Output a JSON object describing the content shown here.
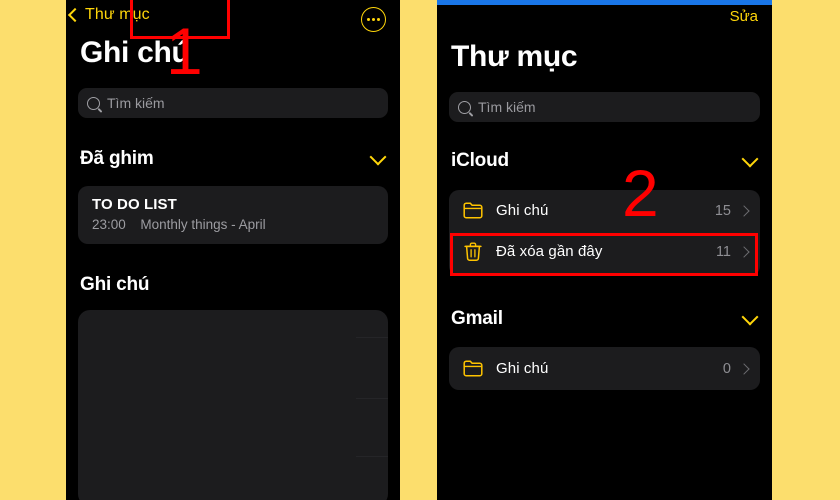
{
  "background": {
    "color": "#FCDE6D"
  },
  "panels": {
    "left": {
      "name": "notes-list-screen",
      "nav": {
        "back_label": "Thư mục",
        "back_icon": "chevron-left-icon",
        "more_icon": "ellipsis-circle-icon"
      },
      "title": "Ghi chú",
      "search": {
        "placeholder": "Tìm kiếm",
        "icon": "search-icon"
      },
      "sections": [
        {
          "label": "Đã ghim",
          "chevron": "chevron-down-icon",
          "notes": [
            {
              "title": "TO DO LIST",
              "time": "23:00",
              "preview": "Monthly things - April"
            }
          ]
        },
        {
          "label": "Ghi chú",
          "chevron": "",
          "notes": []
        }
      ]
    },
    "right": {
      "name": "folders-screen",
      "nav": {
        "edit_label": "Sửa"
      },
      "title": "Thư mục",
      "search": {
        "placeholder": "Tìm kiếm",
        "icon": "search-icon"
      },
      "groups": [
        {
          "label": "iCloud",
          "chevron": "chevron-down-icon",
          "rows": [
            {
              "icon": "folder-icon",
              "label": "Ghi chú",
              "count": "15",
              "chevron": "chevron-right-icon"
            },
            {
              "icon": "trash-icon",
              "label": "Đã xóa gần đây",
              "count": "11",
              "chevron": "chevron-right-icon"
            }
          ]
        },
        {
          "label": "Gmail",
          "chevron": "chevron-down-icon",
          "rows": [
            {
              "icon": "folder-icon",
              "label": "Ghi chú",
              "count": "0",
              "chevron": "chevron-right-icon"
            }
          ]
        }
      ]
    }
  },
  "annotations": {
    "step_one": "1",
    "step_two": "2",
    "color": "#FF0000"
  }
}
